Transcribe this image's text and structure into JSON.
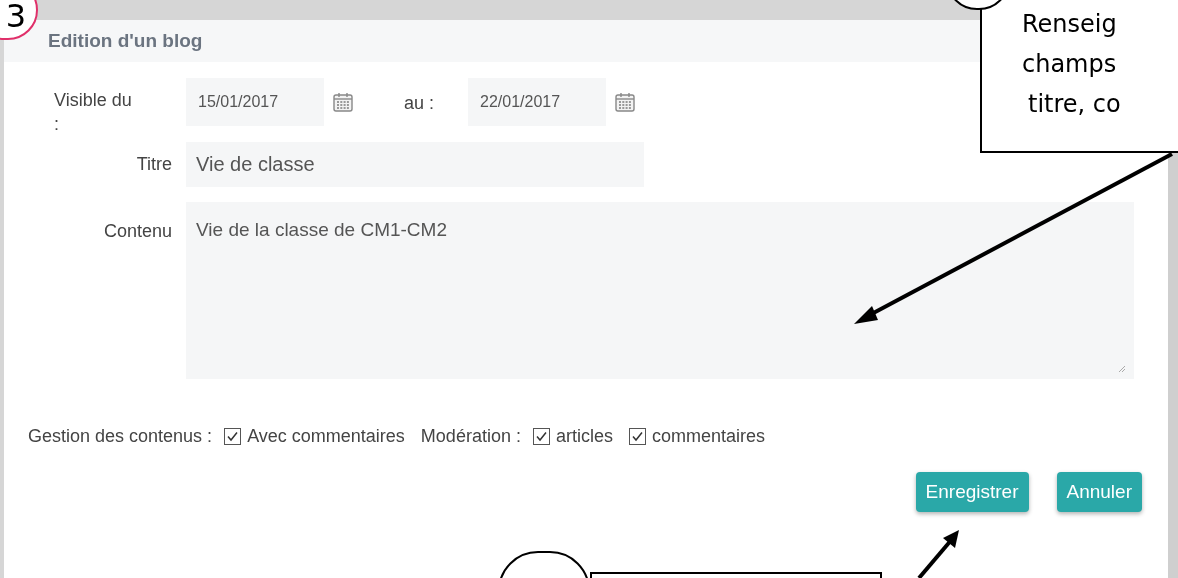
{
  "step_badge": "3",
  "callout": {
    "lines": [
      "Renseig",
      "champs",
      "titre, co"
    ]
  },
  "dialog": {
    "title": "Edition d'un blog",
    "visibility": {
      "from_label": "Visible du :",
      "from_value": "15/01/2017",
      "to_label": "au :",
      "to_value": "22/01/2017"
    },
    "title_field": {
      "label": "Titre",
      "value": "Vie de classe"
    },
    "content_field": {
      "label": "Contenu",
      "value": "Vie de la classe de CM1-CM2"
    },
    "options": [
      {
        "kind": "label",
        "text": "Gestion des contenus :"
      },
      {
        "kind": "checkbox",
        "text": "Avec commentaires",
        "checked": true
      },
      {
        "kind": "label",
        "text": "Modération :"
      },
      {
        "kind": "checkbox",
        "text": "articles",
        "checked": true
      },
      {
        "kind": "checkbox",
        "text": "commentaires",
        "checked": true
      }
    ],
    "buttons": [
      "Enregistrer",
      "Annuler"
    ]
  }
}
